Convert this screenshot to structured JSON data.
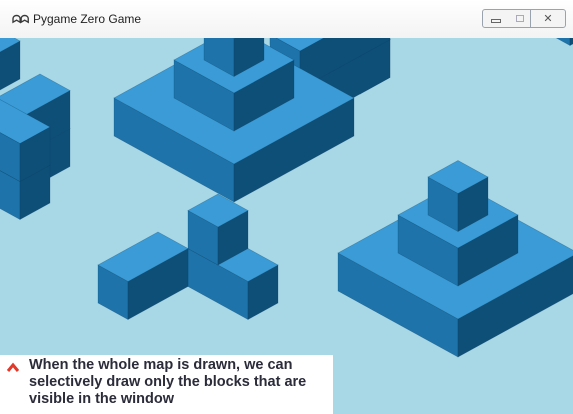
{
  "window": {
    "title": "Pygame Zero Game",
    "app_icon": "pygame-logo-icon",
    "controls": [
      "minimize-icon",
      "maximize-icon",
      "close-icon"
    ]
  },
  "colors": {
    "background": "#a8d7e6",
    "block_top": "#3a9bd6",
    "block_left": "#1e74aa",
    "block_right": "#0e4f78",
    "caption_caret": "#e03a2a"
  },
  "caption": {
    "text": "When the whole map is drawn, we can selectively draw only the blocks that are visible in the window"
  }
}
